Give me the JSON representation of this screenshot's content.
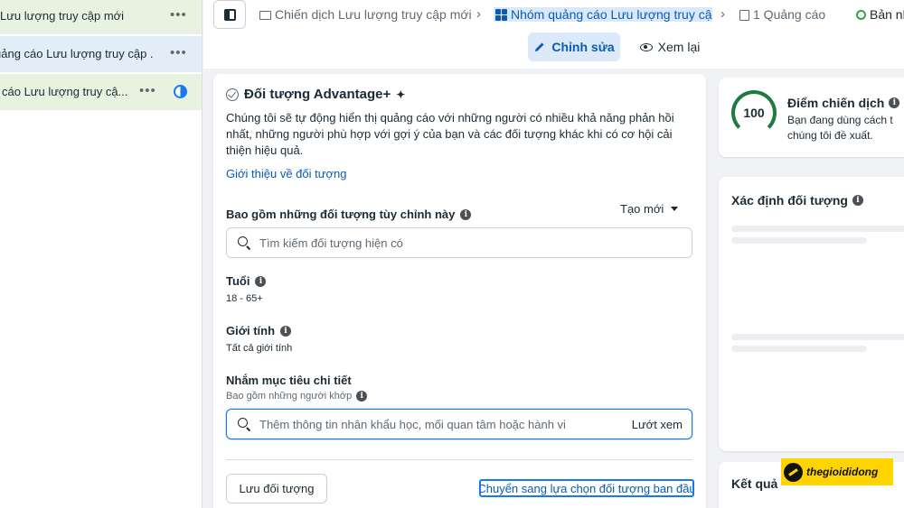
{
  "tree": {
    "items": [
      {
        "label": "Lưu lượng truy cập mới"
      },
      {
        "label": "uảng cáo Lưu lượng truy cập ..."
      },
      {
        "label": "cáo Lưu lượng truy cậ..."
      }
    ],
    "more_label": "•••"
  },
  "topbar": {
    "crumbs": [
      {
        "label": "Chiến dịch Lưu lượng truy cập mới"
      },
      {
        "label": "Nhóm quảng cáo Lưu lượng truy cập"
      },
      {
        "label": "1 Quảng cáo"
      },
      {
        "label": "Bản nh"
      }
    ],
    "separator": "›",
    "edit_label": "Chỉnh sửa",
    "review_label": "Xem lại"
  },
  "audience": {
    "title": "Đối tượng Advantage+",
    "sparkle": "✦",
    "description": "Chúng tôi sẽ tự động hiển thị quảng cáo với những người có nhiều khả năng phản hồi nhất, những người phù hợp với gợi ý của bạn và các đối tượng khác khi có cơ hội cải thiện hiệu quả.",
    "intro_link": "Giới thiệu về đối tượng",
    "custom_title": "Bao gồm những đối tượng tùy chỉnh này",
    "create_new": "Tạo mới",
    "custom_search_placeholder": "Tìm kiếm đối tượng hiện có",
    "age_title": "Tuổi",
    "age_value": "18 - 65+",
    "gender_title": "Giới tính",
    "gender_value": "Tất cả giới tính",
    "targeting_title": "Nhắm mục tiêu chi tiết",
    "targeting_sub": "Bao gồm những người khớp",
    "targeting_placeholder": "Thêm thông tin nhân khẩu học, mối quan tâm hoặc hành vi",
    "browse_label": "Lướt xem",
    "save_label": "Lưu đối tượng",
    "switch_label": "Chuyển sang lựa chọn đối tượng ban đầu"
  },
  "right": {
    "score": "100",
    "score_title": "Điểm chiến dịch",
    "score_desc_1": "Bạn đang dùng cách t",
    "score_desc_2": "chúng tôi đề xuất.",
    "define_title": "Xác định đối tượng",
    "results_title": "Kết quả"
  },
  "info_glyph": "i",
  "watermark": "thegioididong",
  "colors": {
    "accent": "#1877f2",
    "link": "#0a5bb5",
    "score": "#1f7a3d",
    "watermark": "#ffd400"
  }
}
